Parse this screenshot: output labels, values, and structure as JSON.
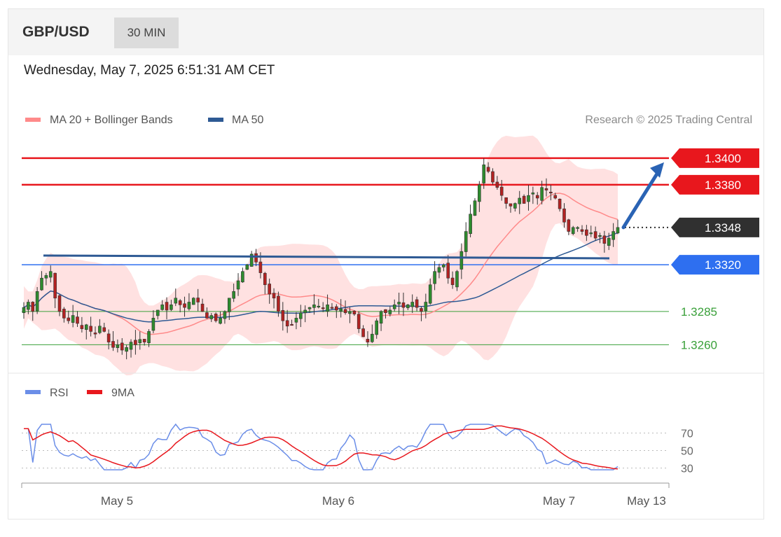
{
  "header": {
    "symbol": "GBP/USD",
    "timeframe": "30 MIN",
    "datetime": "Wednesday, May 7, 2025 6:51:31 AM CET"
  },
  "legend": {
    "ma20_label": "MA 20 + Bollinger Bands",
    "ma50_label": "MA 50",
    "rsi_label": "RSI",
    "rsi_ma_label": "9MA"
  },
  "copyright": "Research © 2025 Trading Central",
  "colors": {
    "resistance": "#e8171d",
    "support_main": "#2e6ff0",
    "support_minor": "#3aa03a",
    "current": "#303030",
    "ma50": "#2e5a94",
    "ma20": "#ff8a8a",
    "bands": "#ffdede",
    "up_candle": "#2e8b2e",
    "down_candle": "#b22222",
    "rsi": "#6b8ee8",
    "rsi_ma": "#e8171d"
  },
  "chart_data": [
    {
      "type": "candlestick",
      "title": "GBP/USD 30 MIN",
      "ylim": [
        1.3245,
        1.3412
      ],
      "levels": [
        {
          "value": 1.34,
          "label": "1.3400",
          "kind": "resistance"
        },
        {
          "value": 1.338,
          "label": "1.3380",
          "kind": "resistance"
        },
        {
          "value": 1.3348,
          "label": "1.3348",
          "kind": "current"
        },
        {
          "value": 1.332,
          "label": "1.3320",
          "kind": "support"
        },
        {
          "value": 1.3285,
          "label": "1.3285",
          "kind": "support_minor"
        },
        {
          "value": 1.326,
          "label": "1.3260",
          "kind": "support_minor"
        }
      ],
      "x_ticks": [
        "May 5",
        "May 6",
        "May 7",
        "May 13"
      ],
      "trendline": {
        "from": 1.3328,
        "to": 1.3328
      },
      "forecast_arrow": {
        "from": 1.3348,
        "to": 1.34
      },
      "series": [
        {
          "name": "MA 20 + Bollinger Bands"
        },
        {
          "name": "MA 50"
        }
      ],
      "close": [
        1.3288,
        1.3292,
        1.3285,
        1.33,
        1.331,
        1.3312,
        1.3315,
        1.3295,
        1.3285,
        1.328,
        1.3278,
        1.3282,
        1.3276,
        1.3272,
        1.3275,
        1.327,
        1.3268,
        1.3274,
        1.327,
        1.3262,
        1.3258,
        1.326,
        1.3256,
        1.3258,
        1.3262,
        1.326,
        1.3264,
        1.3262,
        1.327,
        1.328,
        1.3286,
        1.329,
        1.3286,
        1.329,
        1.3295,
        1.329,
        1.3288,
        1.3292,
        1.3295,
        1.3292,
        1.3285,
        1.328,
        1.3282,
        1.3278,
        1.328,
        1.3285,
        1.3295,
        1.33,
        1.3308,
        1.3315,
        1.332,
        1.3328,
        1.3322,
        1.3314,
        1.3305,
        1.3298,
        1.3295,
        1.3285,
        1.3278,
        1.3274,
        1.3275,
        1.328,
        1.3284,
        1.3286,
        1.3288,
        1.329,
        1.3289,
        1.3287,
        1.329,
        1.3288,
        1.3286,
        1.3287,
        1.3284,
        1.3285,
        1.3283,
        1.3272,
        1.3266,
        1.3262,
        1.3268,
        1.3278,
        1.3285,
        1.3284,
        1.3286,
        1.329,
        1.3292,
        1.3288,
        1.329,
        1.3292,
        1.3288,
        1.3285,
        1.3292,
        1.3305,
        1.3315,
        1.3318,
        1.332,
        1.331,
        1.3305,
        1.3315,
        1.333,
        1.3345,
        1.3358,
        1.3368,
        1.338,
        1.3395,
        1.339,
        1.3382,
        1.3378,
        1.3372,
        1.3366,
        1.3364,
        1.3366,
        1.337,
        1.3366,
        1.3372,
        1.3374,
        1.337,
        1.3378,
        1.3376,
        1.3374,
        1.337,
        1.3362,
        1.3352,
        1.3345,
        1.3348,
        1.3348,
        1.3345,
        1.3342,
        1.3344,
        1.334,
        1.3342,
        1.3336,
        1.334,
        1.3345,
        1.3348
      ]
    },
    {
      "type": "line",
      "ylim": [
        20,
        100
      ],
      "y_ticks": [
        70,
        50,
        30
      ],
      "series": [
        {
          "name": "RSI"
        },
        {
          "name": "9MA"
        }
      ]
    }
  ]
}
